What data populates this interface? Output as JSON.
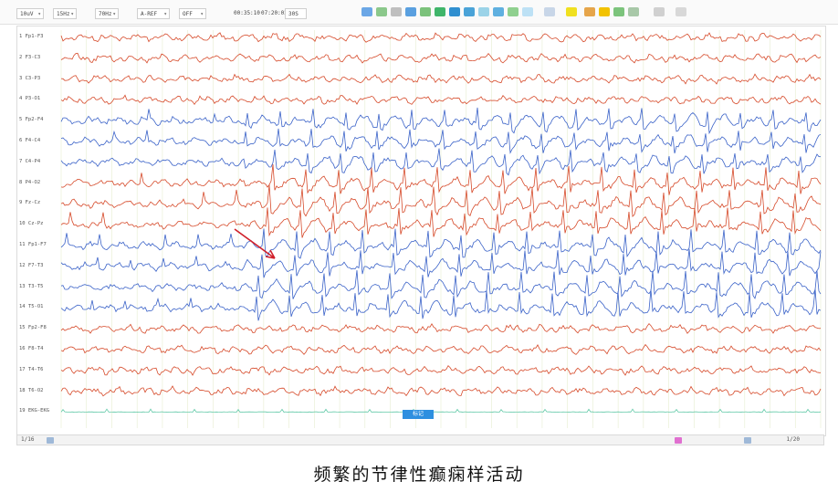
{
  "toolbar": {
    "selects": [
      "10uV",
      "15Hz",
      "70Hz",
      "A-REF",
      "OFF"
    ],
    "times": [
      "00:35:10",
      "07:20:02"
    ],
    "speed": "30S"
  },
  "channels": [
    {
      "label": "1 Fp1-F3",
      "color": "#d64a2a",
      "type": "red"
    },
    {
      "label": "2 F3-C3",
      "color": "#d64a2a",
      "type": "red"
    },
    {
      "label": "3 C3-P3",
      "color": "#d64a2a",
      "type": "red"
    },
    {
      "label": "4 P3-O1",
      "color": "#d64a2a",
      "type": "red"
    },
    {
      "label": "5 Fp2-F4",
      "color": "#3a62c8",
      "type": "blue"
    },
    {
      "label": "6 F4-C4",
      "color": "#3a62c8",
      "type": "blue"
    },
    {
      "label": "7 C4-P4",
      "color": "#3a62c8",
      "type": "blue"
    },
    {
      "label": "8 P4-O2",
      "color": "#d64a2a",
      "type": "redspike"
    },
    {
      "label": "9 Fz-Cz",
      "color": "#d64a2a",
      "type": "redspike"
    },
    {
      "label": "10 Cz-Pz",
      "color": "#d64a2a",
      "type": "redspike"
    },
    {
      "label": "11 Fp1-F7",
      "color": "#3a62c8",
      "type": "bluespike"
    },
    {
      "label": "12 F7-T3",
      "color": "#3a62c8",
      "type": "bluespike"
    },
    {
      "label": "13 T3-T5",
      "color": "#3a62c8",
      "type": "bluespike"
    },
    {
      "label": "14 T5-O1",
      "color": "#3a62c8",
      "type": "bluespike"
    },
    {
      "label": "15 Fp2-F8",
      "color": "#d64a2a",
      "type": "red"
    },
    {
      "label": "16 F8-T4",
      "color": "#d64a2a",
      "type": "red"
    },
    {
      "label": "17 T4-T6",
      "color": "#d64a2a",
      "type": "red"
    },
    {
      "label": "18 T6-O2",
      "color": "#d64a2a",
      "type": "red"
    },
    {
      "label": "19 EKG-EKG",
      "color": "#62c9a8",
      "type": "ecg"
    }
  ],
  "event_marker": "标记",
  "status": {
    "left": "1/16",
    "right": "1/20"
  },
  "caption": "频繁的节律性癫痫样活动"
}
